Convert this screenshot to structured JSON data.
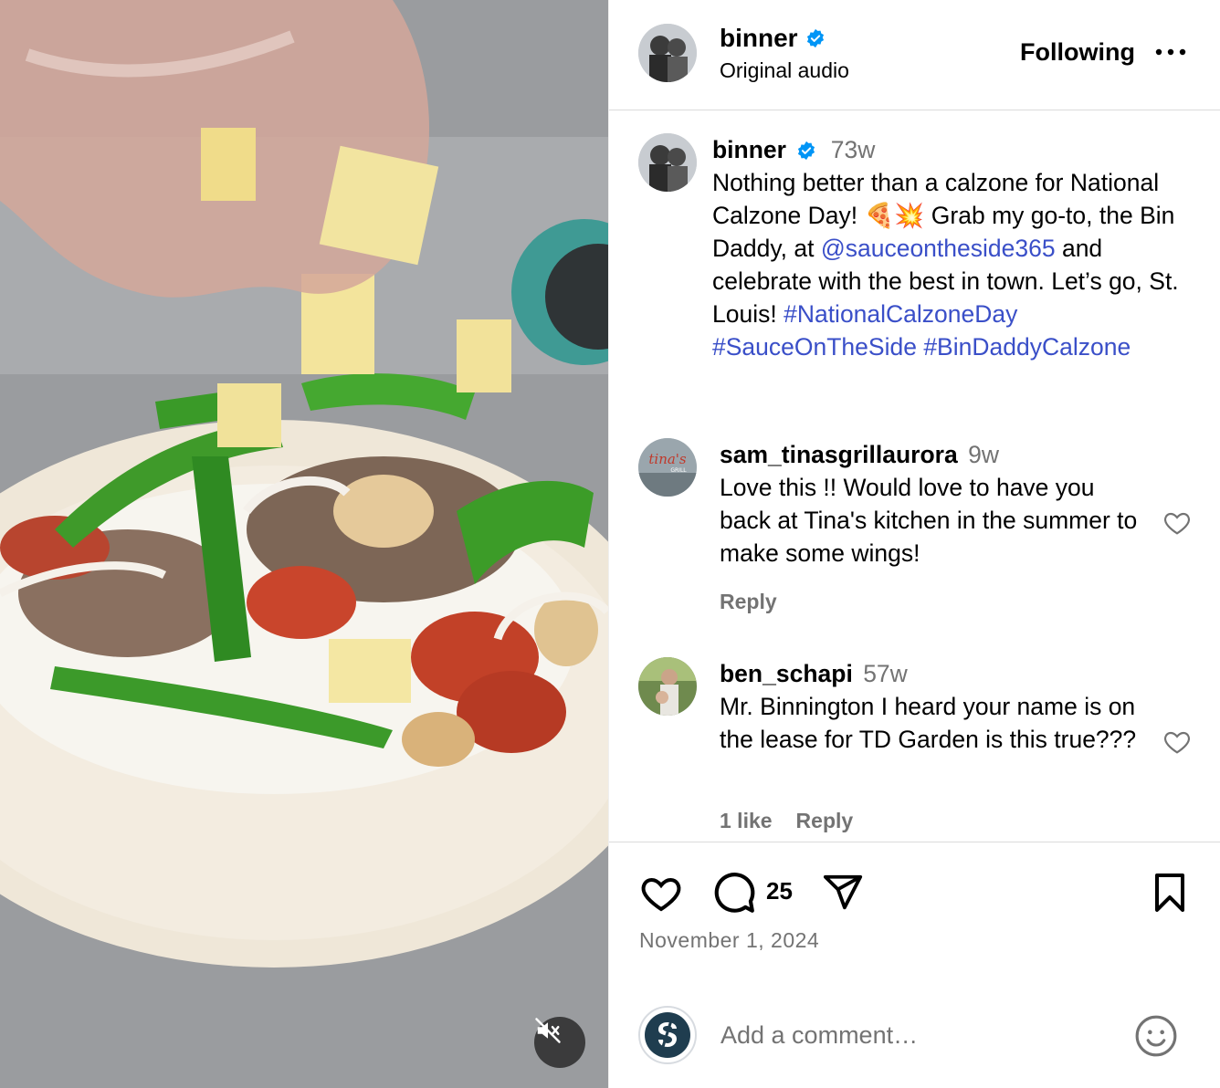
{
  "media": {
    "mute_icon": "speaker-muted-icon"
  },
  "header": {
    "username": "binner",
    "verified_icon": "verified-badge-icon",
    "subtitle": "Original audio",
    "follow_label": "Following",
    "more_icon": "more-horizontal-icon"
  },
  "caption": {
    "username": "binner",
    "time": "73w",
    "text_1": "Nothing better than a calzone for National Calzone Day! 🍕💥 Grab my go-to, the Bin Daddy, at ",
    "mention": "@sauceontheside365",
    "text_2": " and celebrate with the best in town. Let’s go, St. Louis! ",
    "hashtags": [
      "#NationalCalzoneDay",
      "#SauceOnTheSide",
      "#BinDaddyCalzone"
    ]
  },
  "comments": [
    {
      "username": "sam_tinasgrillaurora",
      "avatar_text": "tina's",
      "avatar_subtext": "GRILL",
      "time": "9w",
      "text": "Love this !! Would love to have you back at Tina's kitchen in the summer to make some wings!",
      "likes": "",
      "reply_label": "Reply"
    },
    {
      "username": "ben_schapi",
      "time": "57w",
      "text": "Mr. Binnington I heard your name is on the lease for TD Garden is this true???",
      "likes": "1 like",
      "reply_label": "Reply"
    }
  ],
  "actions": {
    "like_icon": "heart-icon",
    "comment_icon": "comment-icon",
    "comment_count": "25",
    "share_icon": "send-icon",
    "save_icon": "bookmark-icon",
    "date": "November 1, 2024"
  },
  "add_comment": {
    "placeholder": "Add a comment…",
    "emoji_icon": "emoji-smile-icon"
  },
  "colors": {
    "link": "#3a4fc8",
    "verified": "#0095f6",
    "muted_text": "#737373",
    "divider": "#dbdbdb"
  }
}
